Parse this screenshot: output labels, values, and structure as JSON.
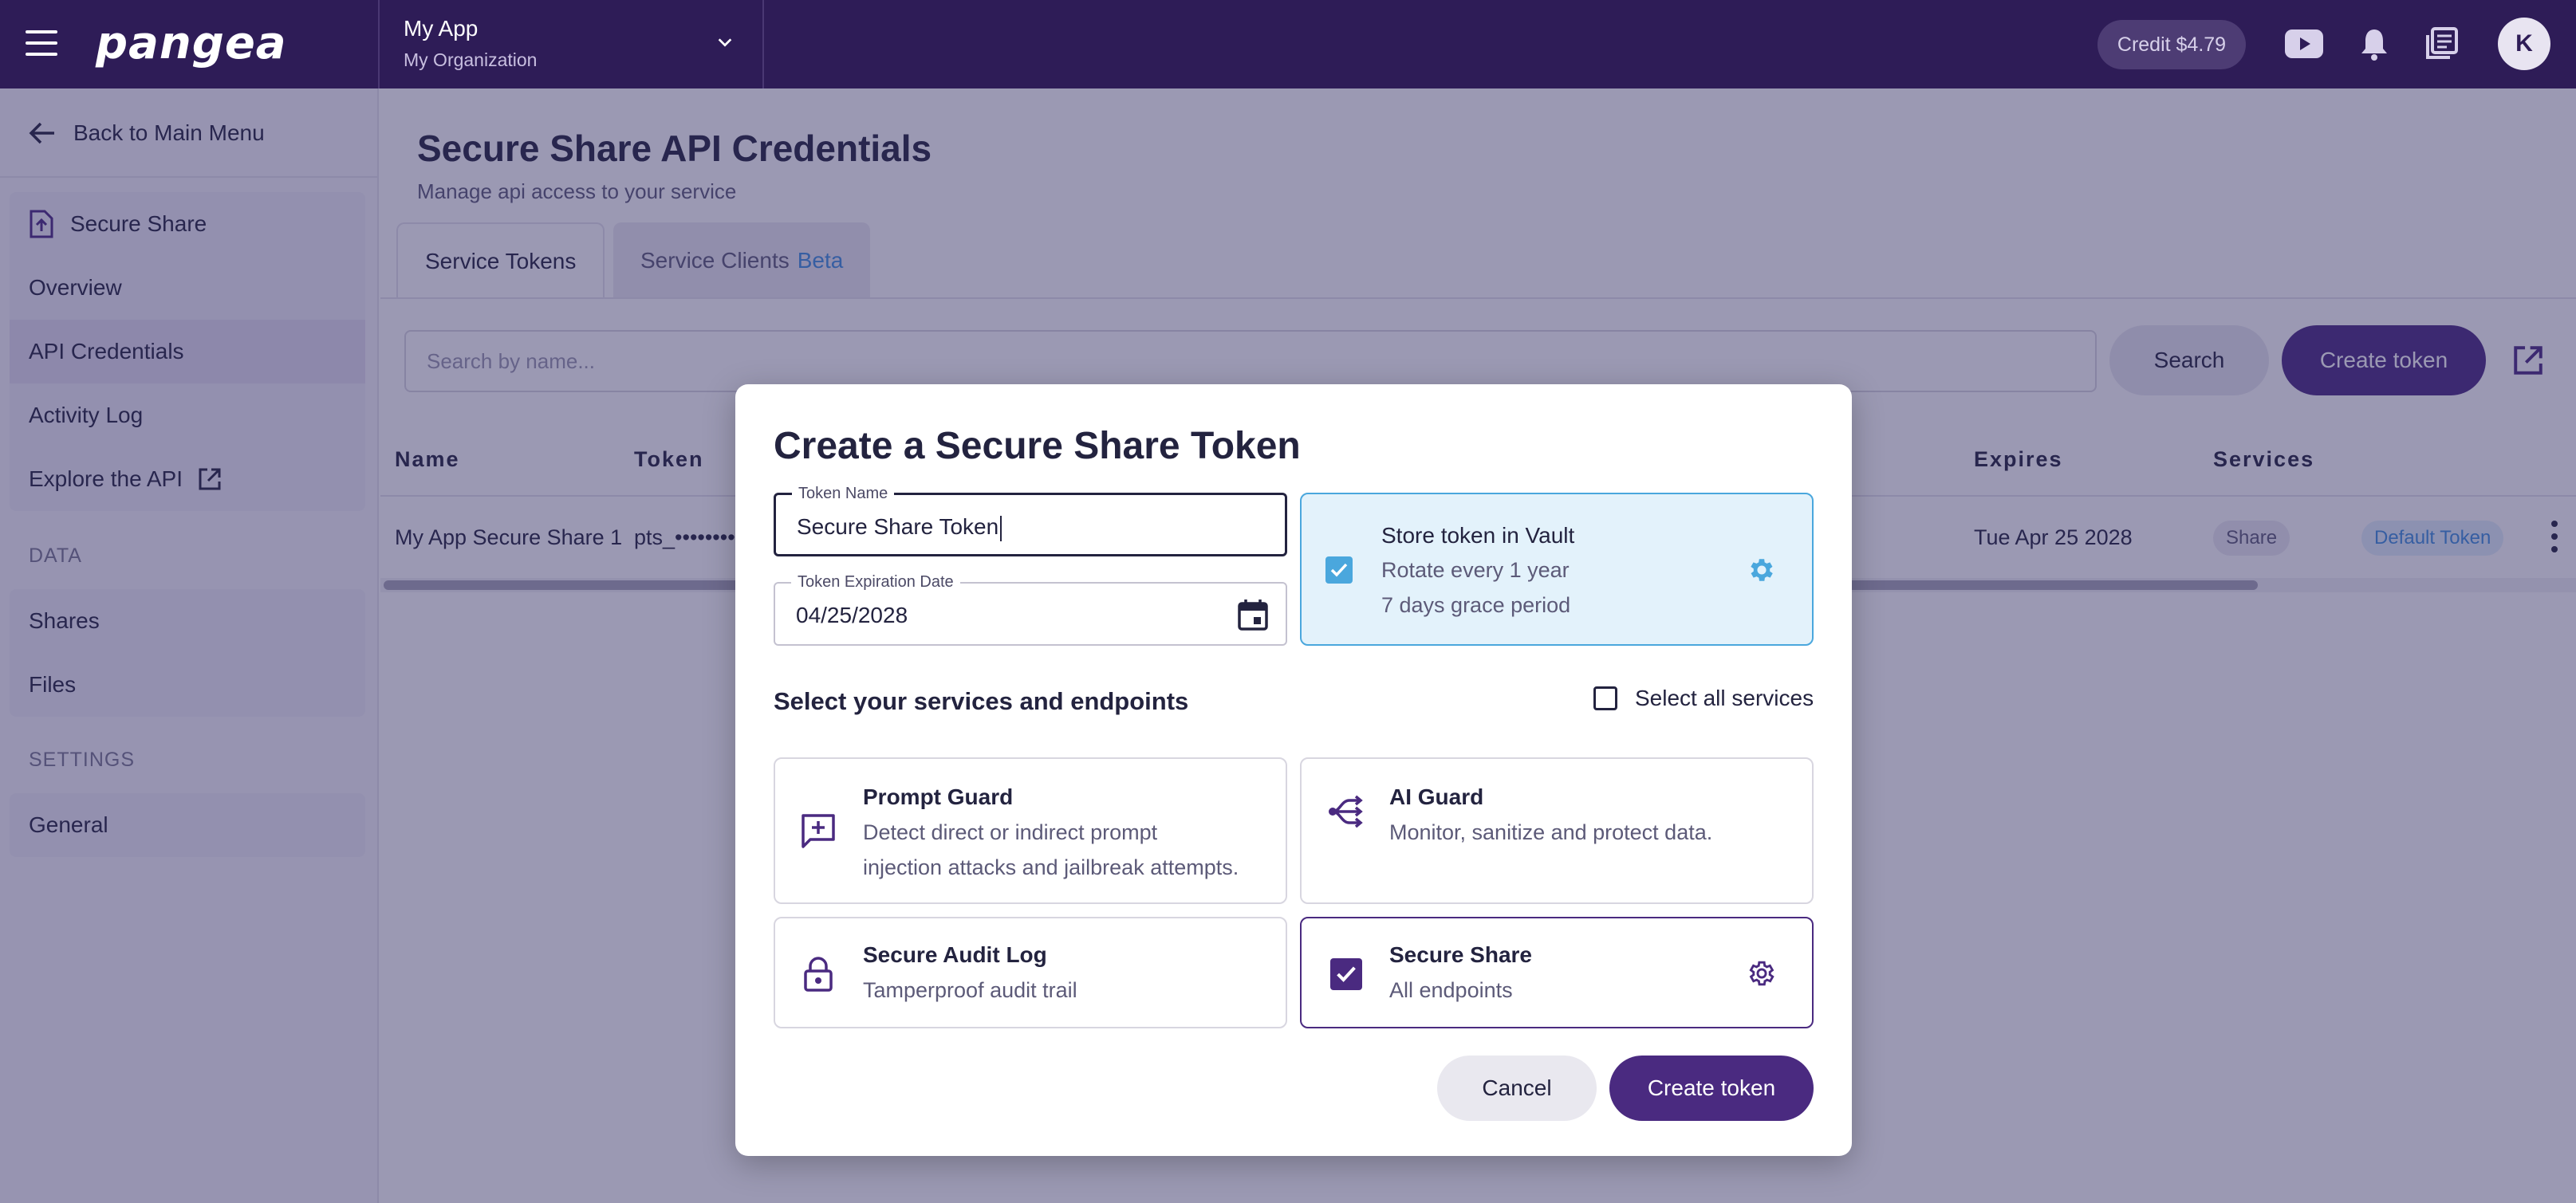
{
  "topbar": {
    "logo": "pangea",
    "app_name": "My App",
    "org_name": "My Organization",
    "credit": "Credit $4.79",
    "avatar_initial": "K"
  },
  "sidebar": {
    "back_label": "Back to Main Menu",
    "service_items": [
      {
        "label": "Secure Share"
      },
      {
        "label": "Overview"
      },
      {
        "label": "API Credentials"
      },
      {
        "label": "Activity Log"
      },
      {
        "label": "Explore the API"
      }
    ],
    "data_section_label": "DATA",
    "data_items": [
      {
        "label": "Shares"
      },
      {
        "label": "Files"
      }
    ],
    "settings_section_label": "SETTINGS",
    "settings_items": [
      {
        "label": "General"
      }
    ]
  },
  "main": {
    "title": "Secure Share API Credentials",
    "subtitle": "Manage api access to your service",
    "tabs": [
      {
        "label": "Service Tokens"
      },
      {
        "label": "Service Clients",
        "badge": "Beta"
      }
    ],
    "search_placeholder": "Search by name...",
    "search_button": "Search",
    "create_button": "Create token",
    "table": {
      "columns": [
        "Name",
        "Token",
        "Expires",
        "Services"
      ],
      "rows": [
        {
          "name": "My App Secure Share 1",
          "token": "pts_••••••••",
          "expires": "Tue Apr 25 2028",
          "service": "Share",
          "tag": "Default Token"
        }
      ]
    }
  },
  "modal": {
    "title": "Create a Secure Share Token",
    "token_name_label": "Token Name",
    "token_name_value": "Secure Share Token",
    "expiration_label": "Token Expiration Date",
    "expiration_value": "04/25/2028",
    "vault": {
      "title": "Store token in Vault",
      "rotation": "Rotate every 1 year",
      "grace": "7 days grace period",
      "checked": true
    },
    "services_label": "Select your services and endpoints",
    "select_all_label": "Select all services",
    "services": [
      {
        "name": "Prompt Guard",
        "desc_line1": "Detect direct or indirect prompt",
        "desc_line2": "injection attacks and jailbreak attempts.",
        "icon": "chat-plus-icon",
        "selected": false
      },
      {
        "name": "AI Guard",
        "desc_line1": "Monitor, sanitize and protect data.",
        "icon": "fork-arrows-icon",
        "selected": false
      },
      {
        "name": "Secure Audit Log",
        "desc_line1": "Tamperproof audit trail",
        "icon": "lock-icon",
        "selected": false
      },
      {
        "name": "Secure Share",
        "desc_line1": "All endpoints",
        "icon": "checkbox-icon",
        "selected": true
      }
    ],
    "cancel_label": "Cancel",
    "create_label": "Create token"
  },
  "colors": {
    "brand": "#2e1c57",
    "primary_button": "#4a2a80",
    "vault_accent": "#4aa7dd",
    "beta": "#3f8ede"
  }
}
